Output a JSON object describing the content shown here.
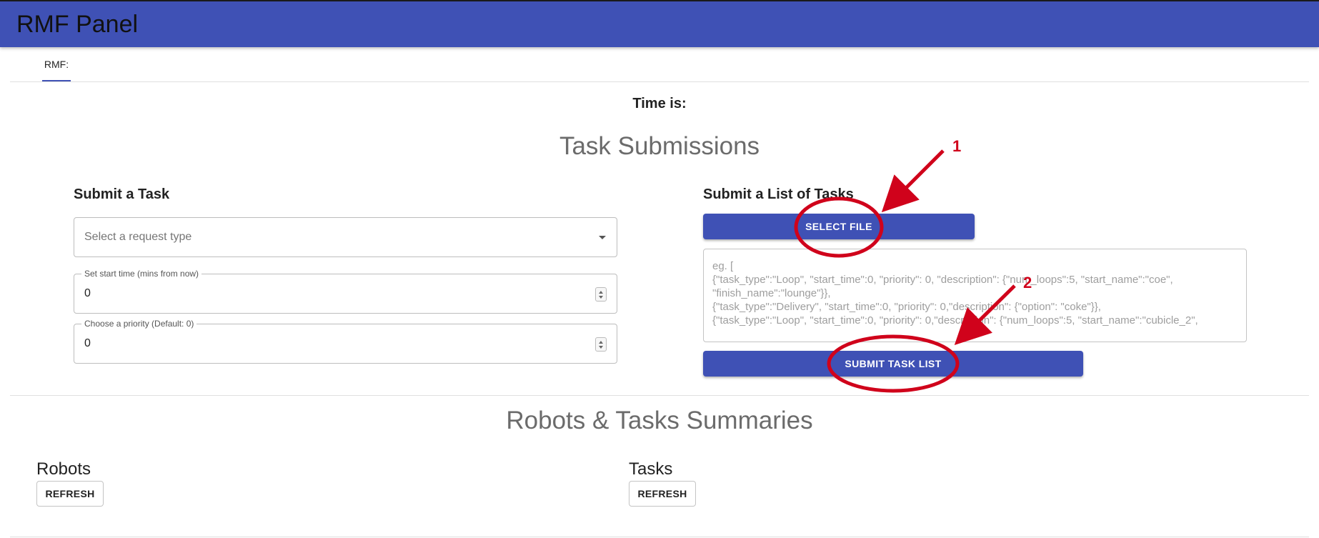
{
  "app": {
    "title": "RMF Panel"
  },
  "tabs": [
    {
      "label": "RMF:"
    }
  ],
  "time": {
    "label": "Time is:"
  },
  "task_submissions": {
    "title": "Task Submissions",
    "single": {
      "heading": "Submit a Task",
      "request_type_placeholder": "Select a request type",
      "start_time": {
        "label": "Set start time (mins from now)",
        "value": "0"
      },
      "priority": {
        "label": "Choose a priority (Default: 0)",
        "value": "0"
      }
    },
    "list": {
      "heading": "Submit a List of Tasks",
      "select_file_label": "SELECT FILE",
      "textarea_placeholder": "eg. [\n{\"task_type\":\"Loop\", \"start_time\":0, \"priority\": 0, \"description\": {\"num_loops\":5, \"start_name\":\"coe\", \"finish_name\":\"lounge\"}},\n{\"task_type\":\"Delivery\", \"start_time\":0, \"priority\": 0,\"description\": {\"option\": \"coke\"}},\n{\"task_type\":\"Loop\", \"start_time\":0, \"priority\": 0,\"description\": {\"num_loops\":5, \"start_name\":\"cubicle_2\",",
      "submit_label": "SUBMIT TASK LIST"
    }
  },
  "summaries": {
    "title": "Robots & Tasks Summaries",
    "robots": {
      "heading": "Robots",
      "refresh_label": "REFRESH"
    },
    "tasks": {
      "heading": "Tasks",
      "refresh_label": "REFRESH"
    }
  },
  "annotations": [
    {
      "label": "1"
    },
    {
      "label": "2"
    }
  ],
  "colors": {
    "primary": "#3f51b5",
    "annotation": "#d0021b"
  }
}
